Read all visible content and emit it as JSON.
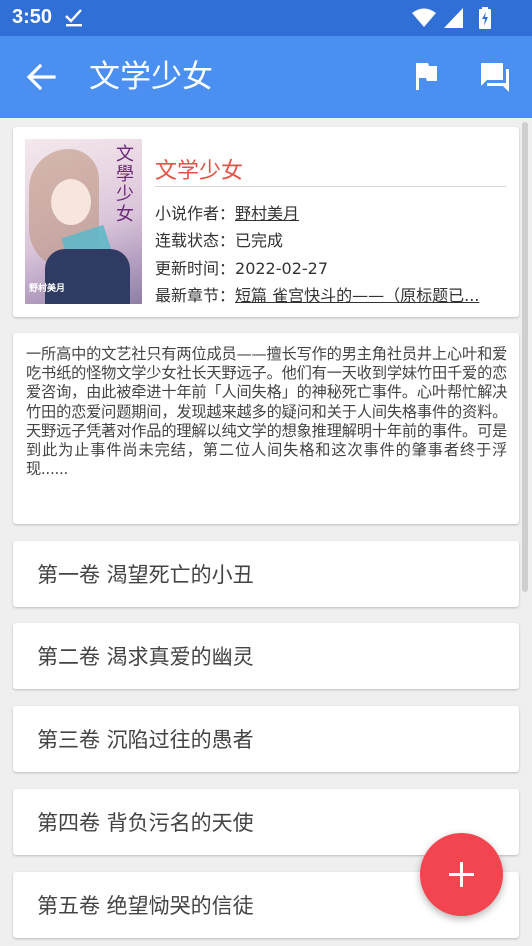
{
  "status_bar": {
    "time": "3:50"
  },
  "app_bar": {
    "title": "文学少女"
  },
  "book": {
    "title": "文学少女",
    "author_label": "小说作者：",
    "author": "野村美月",
    "status_label": "连载状态：",
    "status": "已完成",
    "updated_label": "更新时间：",
    "updated": "2022-02-27",
    "latest_label": "最新章节：",
    "latest": "短篇 雀宫快斗的——（原标题已...",
    "cover_title": "文學少女",
    "cover_author": "野村美月"
  },
  "description": "一所高中的文艺社只有两位成员——擅长写作的男主角社员井上心叶和爱吃书纸的怪物文学少女社长天野远子。他们有一天收到学妹竹田千爱的恋爱咨询，由此被牵进十年前「人间失格」的神秘死亡事件。心叶帮忙解决竹田的恋爱问题期间，发现越来越多的疑问和关于人间失格事件的资料。天野远子凭著对作品的理解以纯文学的想象推理解明十年前的事件。可是到此为止事件尚未完结，第二位人间失格和这次事件的肇事者终于浮现......",
  "volumes": [
    {
      "label": "第一卷 渴望死亡的小丑"
    },
    {
      "label": "第二卷 渴求真爱的幽灵"
    },
    {
      "label": "第三卷 沉陷过往的愚者"
    },
    {
      "label": "第四卷 背负污名的天使"
    },
    {
      "label": "第五卷 绝望恸哭的信徒"
    }
  ],
  "colors": {
    "status_bar": "#2f6fd6",
    "app_bar": "#4b8ff0",
    "book_title": "#e25245",
    "fab": "#f2454f"
  },
  "icons": {
    "back": "arrow-left-icon",
    "flag": "flag-icon",
    "chat": "forum-icon",
    "fab": "plus-icon"
  }
}
